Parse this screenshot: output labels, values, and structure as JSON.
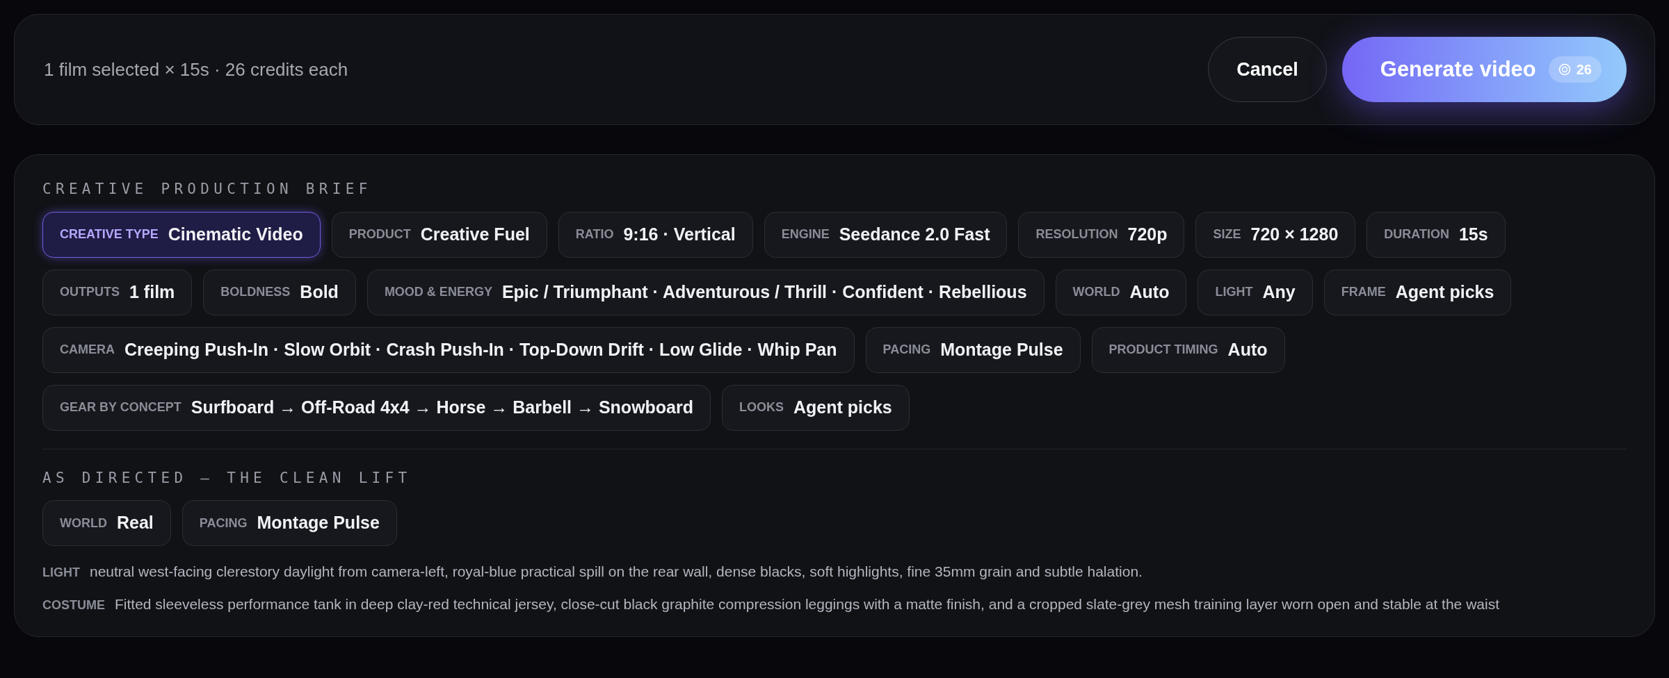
{
  "summary_bar": {
    "text": "1 film selected × 15s · 26 credits each",
    "cancel_label": "Cancel",
    "generate_label": "Generate video",
    "credit_badge": "26"
  },
  "brief": {
    "title": "CREATIVE PRODUCTION BRIEF",
    "chips": [
      {
        "label": "CREATIVE TYPE",
        "value": "Cinematic Video",
        "selected": true
      },
      {
        "label": "PRODUCT",
        "value": "Creative Fuel",
        "selected": false
      },
      {
        "label": "RATIO",
        "value": "9:16 · Vertical",
        "selected": false
      },
      {
        "label": "ENGINE",
        "value": "Seedance 2.0 Fast",
        "selected": false
      },
      {
        "label": "RESOLUTION",
        "value": "720p",
        "selected": false
      },
      {
        "label": "SIZE",
        "value": "720 × 1280",
        "selected": false
      },
      {
        "label": "DURATION",
        "value": "15s",
        "selected": false
      },
      {
        "label": "OUTPUTS",
        "value": "1 film",
        "selected": false
      },
      {
        "label": "BOLDNESS",
        "value": "Bold",
        "selected": false
      },
      {
        "label": "MOOD & ENERGY",
        "value": "Epic / Triumphant · Adventurous / Thrill · Confident · Rebellious",
        "selected": false
      },
      {
        "label": "WORLD",
        "value": "Auto",
        "selected": false
      },
      {
        "label": "LIGHT",
        "value": "Any",
        "selected": false
      },
      {
        "label": "FRAME",
        "value": "Agent picks",
        "selected": false
      },
      {
        "label": "CAMERA",
        "value": "Creeping Push-In · Slow Orbit · Crash Push-In · Top-Down Drift · Low Glide · Whip Pan",
        "selected": false
      },
      {
        "label": "PACING",
        "value": "Montage Pulse",
        "selected": false
      },
      {
        "label": "PRODUCT TIMING",
        "value": "Auto",
        "selected": false
      },
      {
        "label": "GEAR BY CONCEPT",
        "value": "Surfboard → Off-Road 4x4 → Horse → Barbell → Snowboard",
        "selected": false
      },
      {
        "label": "LOOKS",
        "value": "Agent picks",
        "selected": false
      }
    ]
  },
  "directed": {
    "title": "AS DIRECTED — THE CLEAN LIFT",
    "chips": [
      {
        "label": "WORLD",
        "value": "Real"
      },
      {
        "label": "PACING",
        "value": "Montage Pulse"
      }
    ],
    "notes": [
      {
        "label": "LIGHT",
        "text": "neutral west-facing clerestory daylight from camera-left, royal-blue practical spill on the rear wall, dense blacks, soft highlights, fine 35mm grain and subtle halation."
      },
      {
        "label": "COSTUME",
        "text": "Fitted sleeveless performance tank in deep clay-red technical jersey, close-cut black graphite compression leggings with a matte finish, and a cropped slate-grey mesh training layer worn open and stable at the waist"
      }
    ]
  }
}
